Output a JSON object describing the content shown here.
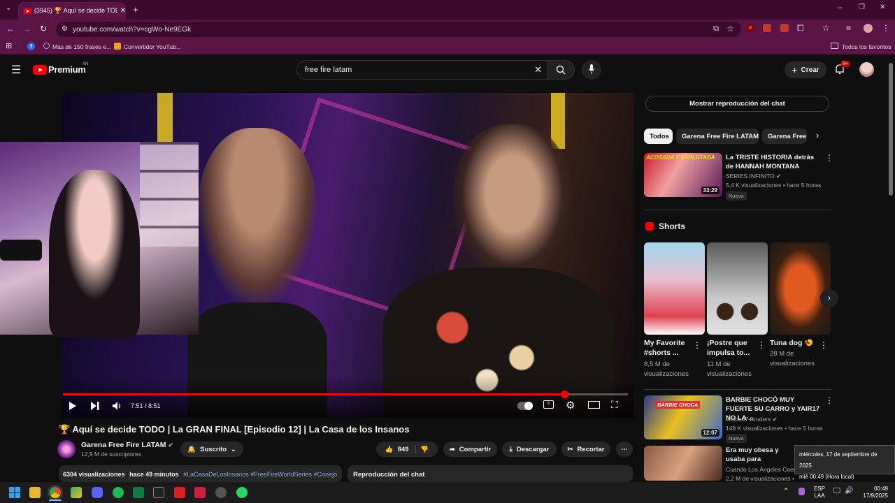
{
  "browser": {
    "tab_title": "(3945) 🏆 Aquí se decide TODO",
    "url": "youtube.com/watch?v=cgWo-Ne9EGk",
    "bookmarks": [
      "Más de 150 frases e...",
      "Convertidor YouTub..."
    ],
    "all_bookmarks": "Todos los favoritos"
  },
  "header": {
    "logo_text": "Premium",
    "region": "AR",
    "search_value": "free fire latam",
    "create_label": "Crear",
    "notifications_badge": "9+"
  },
  "player": {
    "time": "7:51 / 8:51",
    "progress_fraction": 0.887
  },
  "video": {
    "title": "🏆 Aquí se decide TODO | La GRAN FINAL [Episodio 12] | La Casa de los Insanos",
    "channel": "Garena Free Fire LATAM",
    "subscribers": "12,9 M de suscriptores",
    "subscribed_label": "Suscrito",
    "likes": "849",
    "share_label": "Compartir",
    "download_label": "Descargar",
    "clip_label": "Recortar",
    "views": "6304 visualizaciones",
    "published": "hace 49 minutos",
    "hashtags": "#LaCasaDeLosInsanos #FreeFireWorldSeries #Conejo",
    "chat_replay_label": "Reproducción del chat"
  },
  "sidebar": {
    "show_chat": "Mostrar reproducción del chat",
    "chips": [
      "Todos",
      "Garena Free Fire LATAM",
      "Garena Free F"
    ],
    "videos": [
      {
        "title": "La TRISTE HISTORIA detrás de HANNAH MONTANA",
        "channel": "SERIES INFINITO",
        "meta": "5,4 K visualizaciones • hace 5 horas",
        "badge": "Nuevo",
        "duration": "33:29",
        "thumb_text": "ACOSADA Y EXPLOTADA"
      },
      {
        "title": "BARBIE CHOCÓ MUY FUERTE SU CARRO y YAIR17 NO LA ...",
        "channel": "Josue07 Broders",
        "meta": "148 K visualizaciones • hace 5 horas",
        "badge": "Nuevo",
        "duration": "12:07",
        "thumb_text": "BARBIE CHOCA"
      },
      {
        "title": "Era muy obesa y usaba para conquistar a los ch",
        "channel": "Cuando Los Ángeles Caen",
        "meta": "2,2 M de visualizaciones • hace 1 mes"
      }
    ],
    "shorts_heading": "Shorts",
    "shorts": [
      {
        "title": "My Favorite #shorts ...",
        "views": "8,5 M de visualizaciones"
      },
      {
        "title": "¡Postre que impulsa to...",
        "views": "11 M de visualizaciones"
      },
      {
        "title": "Tuna dog 🍤",
        "views": "28 M de visualizaciones"
      }
    ]
  },
  "tooltip": {
    "date": "miércoles, 17 de septiembre de 2025",
    "time": "mié 00:49 (Hora local)"
  },
  "taskbar": {
    "lang": "ESP",
    "layout": "LAA",
    "clock_time": "00:49",
    "clock_date": "17/9/2025"
  }
}
